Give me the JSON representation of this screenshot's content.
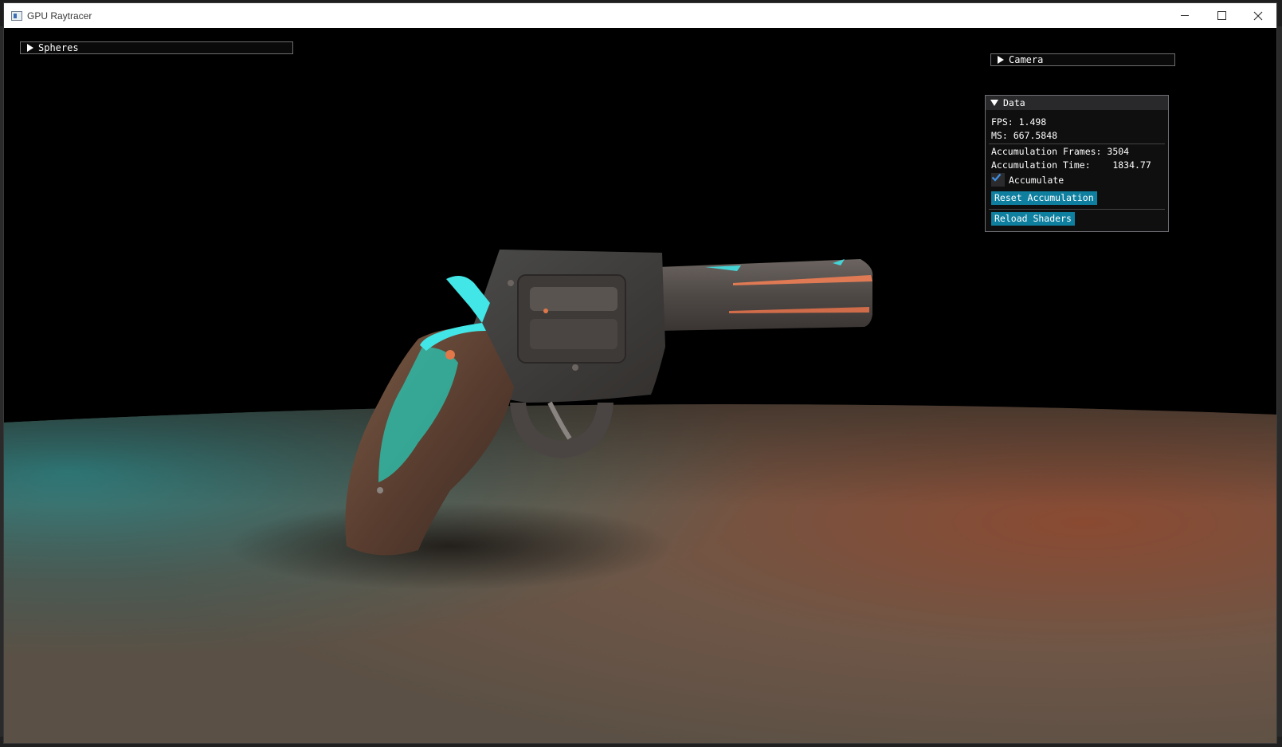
{
  "window": {
    "title": "GPU Raytracer",
    "controls": {
      "minimize": "minimize-icon",
      "maximize": "maximize-icon",
      "close": "close-icon"
    }
  },
  "panels": {
    "spheres": {
      "label": "Spheres",
      "collapsed": true
    },
    "camera": {
      "label": "Camera",
      "collapsed": true
    },
    "data": {
      "label": "Data",
      "fps_label": "FPS: 1.498",
      "ms_label": "MS: 667.5848",
      "accum_frames_label": "Accumulation Frames: 3504",
      "accum_time_label": "Accumulation Time:    1834.77",
      "accumulate_label": "Accumulate",
      "accumulate_checked": true,
      "reset_button": "Reset Accumulation",
      "reload_button": "Reload Shaders"
    }
  },
  "colors": {
    "button": "#0f7fa0",
    "panel_bg": "#0f0f10",
    "panel_header": "#29292c",
    "checkmark": "#3f8fe0",
    "light_teal": "#43e6e6",
    "light_orange": "#e0784a"
  }
}
